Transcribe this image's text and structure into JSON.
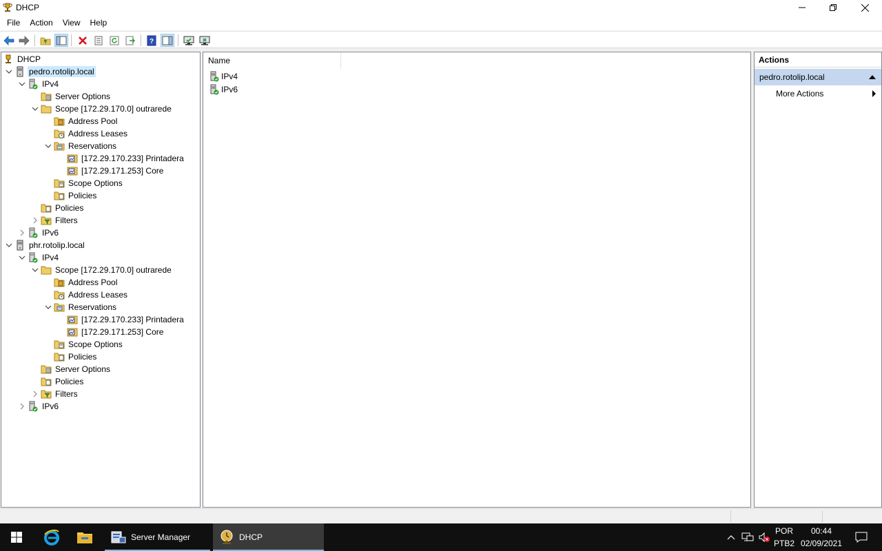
{
  "window": {
    "title": "DHCP"
  },
  "menu": [
    "File",
    "Action",
    "View",
    "Help"
  ],
  "tree": {
    "root": "DHCP",
    "nodes": [
      {
        "label": "pedro.rotolip.local",
        "icon": "server-icon",
        "toggle": "expanded",
        "selected": true
      },
      {
        "label": "IPv4",
        "icon": "ipv4-icon",
        "toggle": "expanded"
      },
      {
        "label": "Server Options",
        "icon": "server-options-icon",
        "toggle": "none"
      },
      {
        "label": "Scope [172.29.170.0] outrarede",
        "icon": "scope-folder-icon",
        "toggle": "expanded"
      },
      {
        "label": "Address Pool",
        "icon": "address-pool-icon",
        "toggle": "none"
      },
      {
        "label": "Address Leases",
        "icon": "address-leases-icon",
        "toggle": "none"
      },
      {
        "label": "Reservations",
        "icon": "reservations-icon",
        "toggle": "expanded"
      },
      {
        "label": "[172.29.170.233] Printadera",
        "icon": "reservation-icon",
        "toggle": "none"
      },
      {
        "label": "[172.29.171.253] Core",
        "icon": "reservation-icon",
        "toggle": "none"
      },
      {
        "label": "Scope Options",
        "icon": "scope-options-icon",
        "toggle": "none"
      },
      {
        "label": "Policies",
        "icon": "policies-icon",
        "toggle": "none"
      },
      {
        "label": "Policies",
        "icon": "policies-icon",
        "toggle": "none"
      },
      {
        "label": "Filters",
        "icon": "filters-icon",
        "toggle": "collapsed"
      },
      {
        "label": "IPv6",
        "icon": "ipv6-icon",
        "toggle": "collapsed"
      },
      {
        "label": "phr.rotolip.local",
        "icon": "server-icon",
        "toggle": "expanded"
      },
      {
        "label": "IPv4",
        "icon": "ipv4-icon",
        "toggle": "expanded"
      },
      {
        "label": "Scope [172.29.170.0] outrarede",
        "icon": "scope-folder-icon",
        "toggle": "expanded"
      },
      {
        "label": "Address Pool",
        "icon": "address-pool-icon",
        "toggle": "none"
      },
      {
        "label": "Address Leases",
        "icon": "address-leases-icon",
        "toggle": "none"
      },
      {
        "label": "Reservations",
        "icon": "reservations-icon",
        "toggle": "expanded"
      },
      {
        "label": "[172.29.170.233] Printadera",
        "icon": "reservation-icon",
        "toggle": "none"
      },
      {
        "label": "[172.29.171.253] Core",
        "icon": "reservation-icon",
        "toggle": "none"
      },
      {
        "label": "Scope Options",
        "icon": "scope-options-icon",
        "toggle": "none"
      },
      {
        "label": "Policies",
        "icon": "policies-icon",
        "toggle": "none"
      },
      {
        "label": "Server Options",
        "icon": "server-options-icon",
        "toggle": "none"
      },
      {
        "label": "Policies",
        "icon": "policies-icon",
        "toggle": "none"
      },
      {
        "label": "Filters",
        "icon": "filters-icon",
        "toggle": "collapsed"
      },
      {
        "label": "IPv6",
        "icon": "ipv6-icon",
        "toggle": "collapsed"
      }
    ]
  },
  "list": {
    "column": "Name",
    "items": [
      {
        "label": "IPv4",
        "icon": "ipv4-icon"
      },
      {
        "label": "IPv6",
        "icon": "ipv6-icon"
      }
    ]
  },
  "actions": {
    "title": "Actions",
    "section": "pedro.rotolip.local",
    "more": "More Actions"
  },
  "taskbar": {
    "apps": [
      {
        "label": "Server Manager",
        "icon": "server-manager-icon"
      },
      {
        "label": "DHCP",
        "icon": "dhcp-icon"
      }
    ],
    "lang": "POR",
    "layout": "PTB2",
    "time": "00:44",
    "date": "02/09/2021"
  },
  "colors": {
    "selection": "#cce8ff",
    "actions_section": "#c4d7ee",
    "taskbar": "#101010",
    "accent": "#76b9ed"
  }
}
